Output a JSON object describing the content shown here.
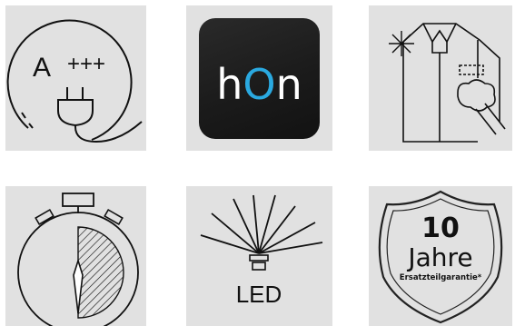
{
  "tiles": [
    {
      "label_left": "A",
      "label_right": "+++",
      "icon": "energy-efficiency-plug-icon"
    },
    {
      "app_prefix": "h",
      "app_accent": "O",
      "app_suffix": "n",
      "icon": "hon-app-icon",
      "accent_color": "#2aa9e0"
    },
    {
      "icon": "shirt-steam-care-icon"
    },
    {
      "icon": "stopwatch-timer-icon"
    },
    {
      "label": "LED",
      "icon": "led-light-icon"
    },
    {
      "number": "10",
      "word": "Jahre",
      "caption": "Ersatzteilgarantie*",
      "icon": "warranty-shield-icon"
    }
  ]
}
